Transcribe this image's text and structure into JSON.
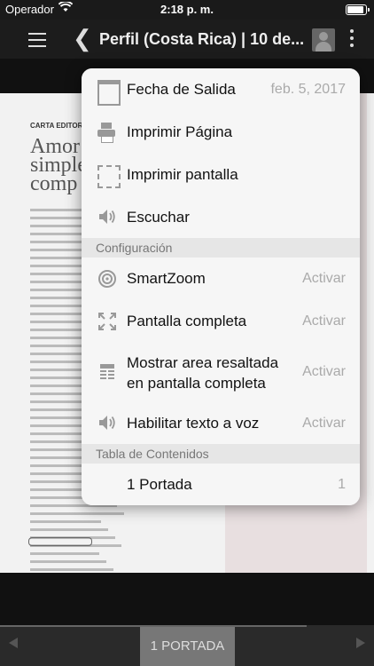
{
  "status_bar": {
    "carrier": "Operador",
    "time": "2:18 p. m.",
    "battery_level": 1.0
  },
  "nav": {
    "title": "Perfil (Costa Rica)  |  10 de..."
  },
  "page_preview": {
    "section_label": "CARTA EDITORIAL",
    "headline": [
      "Amor",
      "simple",
      "comp"
    ]
  },
  "menu": {
    "items": [
      {
        "label": "Fecha de Salida",
        "value": "feb. 5, 2017",
        "icon": "calendar-icon"
      },
      {
        "label": "Imprimir Página",
        "value": "",
        "icon": "printer-icon"
      },
      {
        "label": "Imprimir pantalla",
        "value": "",
        "icon": "screen-capture-icon"
      },
      {
        "label": "Escuchar",
        "value": "",
        "icon": "speaker-icon"
      }
    ],
    "config_header": "Configuración",
    "config_items": [
      {
        "label": "SmartZoom",
        "value": "Activar",
        "icon": "smartzoom-icon"
      },
      {
        "label": "Pantalla completa",
        "value": "Activar",
        "icon": "fullscreen-icon"
      },
      {
        "label": "Mostrar area resaltada en pantalla completa",
        "label_line1": "Mostrar area resaltada",
        "label_line2": "en pantalla completa",
        "value": "Activar",
        "icon": "highlight-area-icon"
      },
      {
        "label": "Habilitar texto a voz",
        "value": "Activar",
        "icon": "text-to-speech-icon"
      }
    ],
    "toc_header": "Tabla de Contenidos",
    "toc_items": [
      {
        "label": "1 Portada",
        "page": "1"
      }
    ]
  },
  "bottom_bar": {
    "current_section": "1 PORTADA",
    "progress": 0.82
  }
}
